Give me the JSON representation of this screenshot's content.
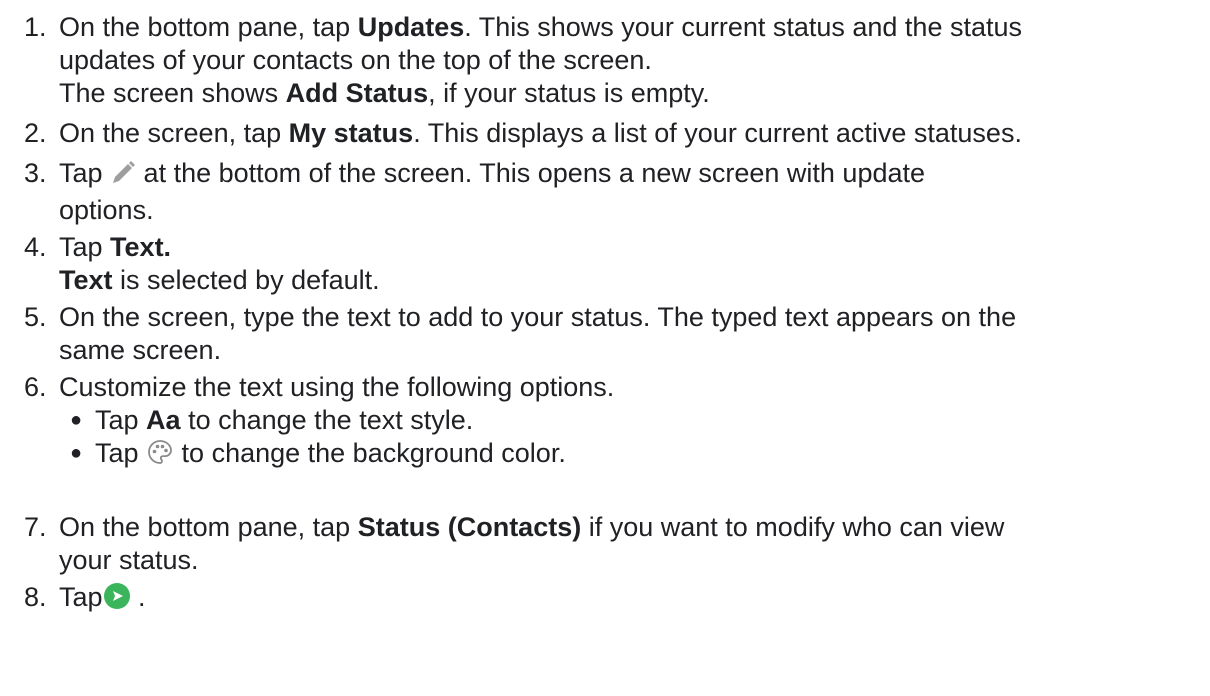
{
  "steps": [
    {
      "num": "1.",
      "lines": [
        [
          "On the bottom pane, tap ",
          "Updates",
          ". This shows your current status and the status"
        ],
        [
          "updates of your contacts on the top of the screen."
        ],
        [
          "The screen shows ",
          "Add Status",
          ", if your status is empty."
        ]
      ]
    },
    {
      "num": "2.",
      "line": [
        "On the screen, tap ",
        "My status",
        ". This displays a list of your current active statuses."
      ]
    },
    {
      "num": "3.",
      "pre": "Tap ",
      "icon": "pencil-icon",
      "post": " at the bottom of the screen. This opens a new screen with update",
      "cont": "options."
    },
    {
      "num": "4.",
      "pre": "Tap ",
      "bold": "Text.",
      "note_bold": "Text",
      "note": " is selected by default."
    },
    {
      "num": "5.",
      "line1": "On the screen, type the text to add to your status. The typed text appears on the",
      "line2": "same screen."
    },
    {
      "num": "6.",
      "line": "Customize the text using the following options.",
      "bullets": [
        {
          "pre": "Tap ",
          "bold": "Aa",
          "post": " to change the text style."
        },
        {
          "pre": "Tap ",
          "icon": "palette-icon",
          "post": " to change the background color."
        }
      ]
    },
    {
      "num": "7.",
      "pre": "On the bottom pane, tap ",
      "bold": "Status (Contacts)",
      "post": " if you want to modify who can view",
      "cont": "your status."
    },
    {
      "num": "8.",
      "pre": "Tap",
      "icon": "send-icon",
      "post": " ."
    }
  ],
  "colors": {
    "text": "#202124",
    "send_button": "#3bb55b",
    "icon_gray": "#9e9e9e"
  }
}
